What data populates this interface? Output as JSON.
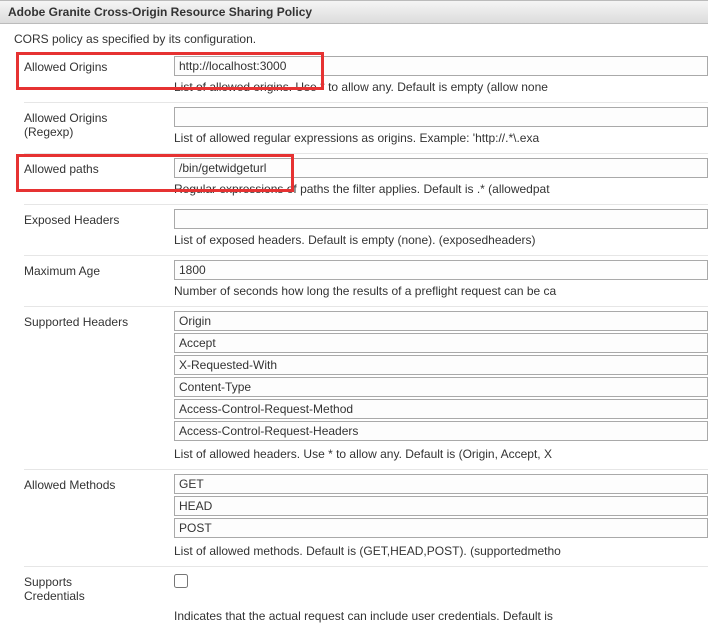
{
  "header": {
    "title": "Adobe Granite Cross-Origin Resource Sharing Policy"
  },
  "subtitle": "CORS policy as specified by its configuration.",
  "fields": {
    "allowed_origins": {
      "label": "Allowed Origins",
      "value": "http://localhost:3000",
      "desc": "List of allowed origins. Use * to allow any. Default is empty (allow none"
    },
    "allowed_origins_regexp": {
      "label_line1": "Allowed Origins",
      "label_line2": "(Regexp)",
      "value": "",
      "desc": "List of allowed regular expressions as origins. Example: 'http://.*\\.exa"
    },
    "allowed_paths": {
      "label": "Allowed paths",
      "value": "/bin/getwidgeturl",
      "desc": "Regular expressions of paths the filter applies. Default is .* (allowedpat"
    },
    "exposed_headers": {
      "label": "Exposed Headers",
      "value": "",
      "desc": "List of exposed headers. Default is empty (none). (exposedheaders)"
    },
    "maximum_age": {
      "label": "Maximum Age",
      "value": "1800",
      "desc": "Number of seconds how long the results of a preflight request can be ca"
    },
    "supported_headers": {
      "label": "Supported Headers",
      "values": [
        "Origin",
        "Accept",
        "X-Requested-With",
        "Content-Type",
        "Access-Control-Request-Method",
        "Access-Control-Request-Headers"
      ],
      "desc": "List of allowed headers. Use * to allow any. Default is (Origin, Accept, X"
    },
    "allowed_methods": {
      "label": "Allowed Methods",
      "values": [
        "GET",
        "HEAD",
        "POST"
      ],
      "desc": "List of allowed methods. Default is (GET,HEAD,POST). (supportedmetho"
    },
    "supports_credentials": {
      "label_line1": "Supports",
      "label_line2": "Credentials",
      "checked": false,
      "desc": "Indicates that the actual request can include user credentials. Default is"
    }
  }
}
